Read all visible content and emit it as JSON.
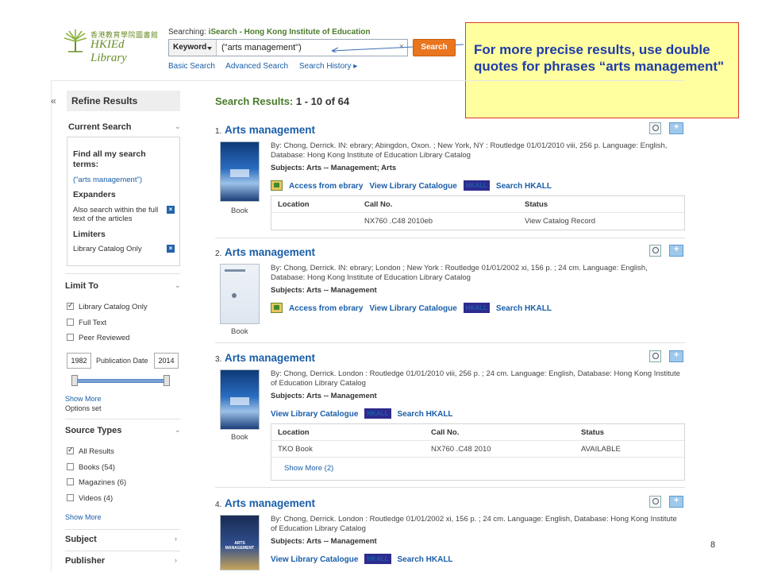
{
  "header": {
    "logo_cn": "香港教育學院圖書館",
    "logo_en": "HKIEd Library",
    "searching_label": "Searching:",
    "searching_db": "iSearch - Hong Kong Institute of Education",
    "field_select": "Keyword",
    "query": "(\"arts management\")",
    "search_button": "Search",
    "links": [
      "Basic Search",
      "Advanced Search",
      "Search History ▸"
    ]
  },
  "callout": {
    "text": "For more precise results, use double quotes for phrases “arts management\""
  },
  "sidebar": {
    "collapse": "«",
    "refine_title": "Refine Results",
    "current_search": {
      "heading": "Current Search",
      "find_all": "Find all my search terms:",
      "term": "(\"arts management\")",
      "expanders": "Expanders",
      "expander_item": "Also search within the full text of the articles",
      "limiters": "Limiters",
      "limiter_item": "Library Catalog Only"
    },
    "limit_to": {
      "heading": "Limit To",
      "items": [
        {
          "label": "Library Catalog Only",
          "checked": true
        },
        {
          "label": "Full Text",
          "checked": false
        },
        {
          "label": "Peer Reviewed",
          "checked": false
        }
      ],
      "date_from": "1982",
      "date_label": "Publication Date",
      "date_to": "2014",
      "show_more": "Show More",
      "options_set": "Options set"
    },
    "source_types": {
      "heading": "Source Types",
      "items": [
        {
          "label": "All Results",
          "checked": true
        },
        {
          "label": "Books (54)",
          "checked": false
        },
        {
          "label": "Magazines (6)",
          "checked": false
        },
        {
          "label": "Videos (4)",
          "checked": false
        }
      ],
      "show_more": "Show More"
    },
    "subject": "Subject",
    "publisher": "Publisher"
  },
  "results": {
    "label": "Search Results:",
    "range": "1 - 10 of 64",
    "items": [
      {
        "num": "1.",
        "title": "Arts management",
        "by": "By: Chong, Derrick. IN: ebrary; Abingdon, Oxon. ; New York, NY : Routledge 01/01/2010 viii, 256 p. Language: English, Database: Hong Kong Institute of Education Library Catalog",
        "subjects": "Subjects: Arts -- Management; Arts",
        "type": "Book",
        "links": [
          "Access from ebrary",
          "View Library Catalogue",
          "HKALL",
          "Search HKALL"
        ],
        "holdings_head": [
          "Location",
          "Call No.",
          "Status"
        ],
        "holdings_rows": [
          [
            "",
            "NX760 .C48 2010eb",
            "View Catalog Record"
          ]
        ]
      },
      {
        "num": "2.",
        "title": "Arts management",
        "by": "By: Chong, Derrick. IN: ebrary; London ; New York : Routledge 01/01/2002 xi, 156 p. ; 24 cm. Language: English, Database: Hong Kong Institute of Education Library Catalog",
        "subjects": "Subjects: Arts -- Management",
        "type": "Book",
        "links": [
          "Access from ebrary",
          "View Library Catalogue",
          "HKALL",
          "Search HKALL"
        ]
      },
      {
        "num": "3.",
        "title": "Arts management",
        "by": "By: Chong, Derrick. London : Routledge 01/01/2010 viii, 256 p. ; 24 cm. Language: English, Database: Hong Kong Institute of Education Library Catalog",
        "subjects": "Subjects: Arts -- Management",
        "type": "Book",
        "links": [
          "View Library Catalogue",
          "HKALL",
          "Search HKALL"
        ],
        "holdings_head": [
          "Location",
          "Call No.",
          "Status"
        ],
        "holdings_rows": [
          [
            "TKO Book",
            "NX760 .C48 2010",
            "AVAILABLE"
          ]
        ],
        "show_more": "Show More (2)"
      },
      {
        "num": "4.",
        "title": "Arts management",
        "by": "By: Chong, Derrick. London : Routledge 01/01/2002 xi, 156 p. ; 24 cm. Language: English, Database: Hong Kong Institute of Education Library Catalog",
        "subjects": "Subjects: Arts -- Management",
        "thumb_text": "ARTS MANAGEMENT",
        "links": [
          "View Library Catalogue",
          "HKALL",
          "Search HKALL"
        ]
      }
    ]
  },
  "page_number": "8",
  "colors": {
    "link": "#1a5ea8",
    "green": "#4a7c2c",
    "search_orange": "#e9751f",
    "callout_bg": "#ffffa0",
    "callout_text": "#1f3ca8",
    "hkall_bg": "#2e2b8e"
  }
}
